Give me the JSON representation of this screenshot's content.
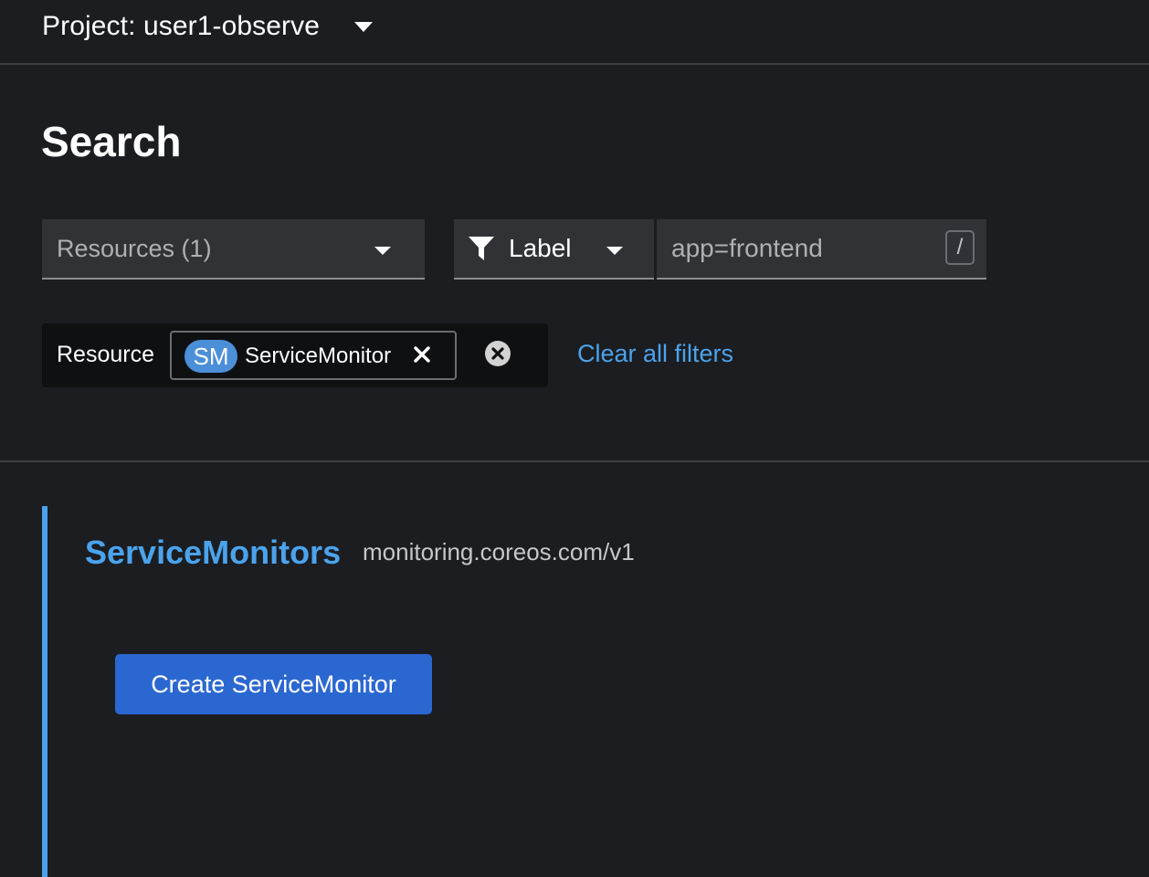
{
  "header": {
    "project_label": "Project: user1-observe"
  },
  "page": {
    "title": "Search"
  },
  "toolbar": {
    "resources_select": "Resources (1)",
    "label_select": "Label",
    "label_input_value": "app=frontend",
    "keyboard_hint": "/"
  },
  "filters": {
    "group_label": "Resource",
    "chip_badge": "SM",
    "chip_text": "ServiceMonitor",
    "clear_all": "Clear all filters"
  },
  "results": {
    "title": "ServiceMonitors",
    "api_group": "monitoring.coreos.com/v1",
    "create_button": "Create ServiceMonitor"
  },
  "colors": {
    "background": "#1b1d21",
    "link": "#4ba3ec",
    "primary_button": "#2b67d0",
    "badge": "#4b8fd9"
  }
}
